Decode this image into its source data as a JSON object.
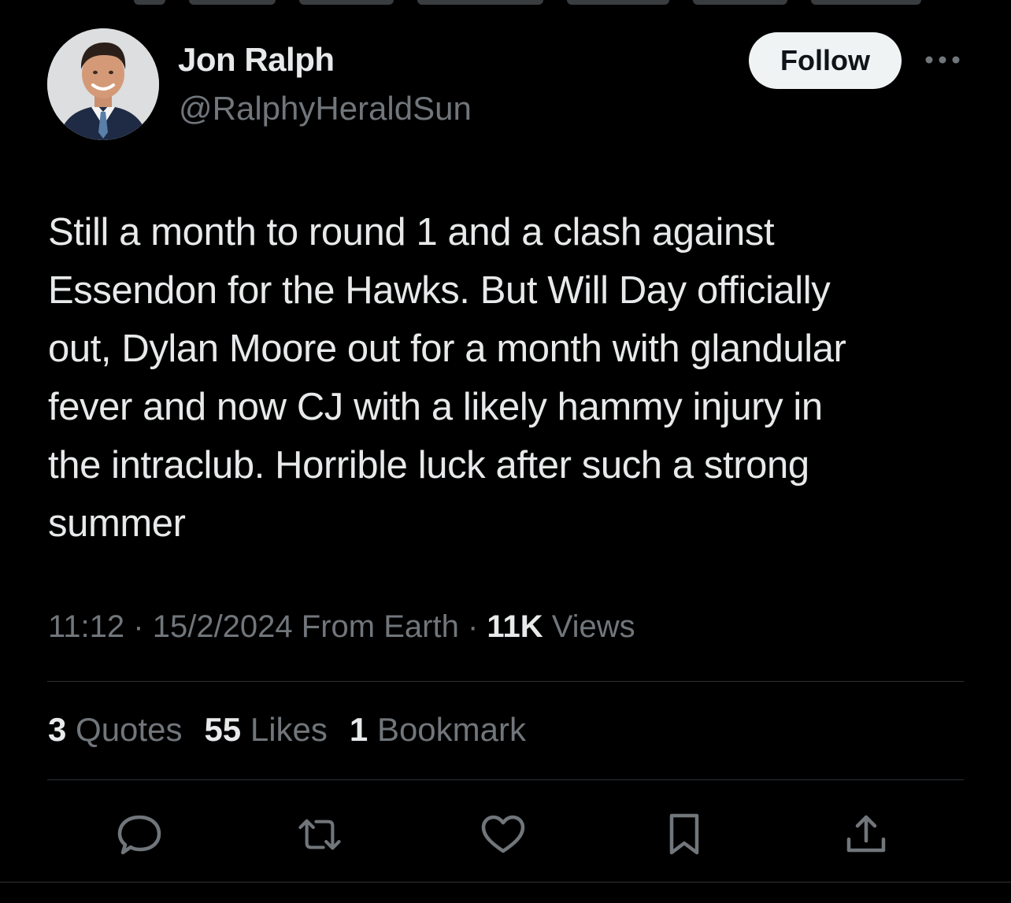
{
  "author": {
    "name": "Jon Ralph",
    "handle": "@RalphyHeraldSun"
  },
  "follow_label": "Follow",
  "tweet": {
    "text": "Still a month to round 1 and a clash against\nEssendon for the Hawks. But Will Day officially\nout, Dylan Moore out for a month with glandular\nfever and now CJ with a likely hammy injury in\nthe intraclub. Horrible luck after such a strong\nsummer"
  },
  "meta": {
    "time": "11:12",
    "separator": "·",
    "date_source": "15/2/2024 From Earth",
    "views_count": "11K",
    "views_label": "Views"
  },
  "stats": {
    "quotes_count": "3",
    "quotes_label": "Quotes",
    "likes_count": "55",
    "likes_label": "Likes",
    "bookmarks_count": "1",
    "bookmarks_label": "Bookmark"
  },
  "icons": {
    "reply": "reply-icon",
    "retweet": "retweet-icon",
    "like": "heart-icon",
    "bookmark": "bookmark-icon",
    "share": "share-icon",
    "more": "more-icon"
  },
  "colors": {
    "background": "#000000",
    "text_primary": "#e7e9ea",
    "text_secondary": "#71767b",
    "divider": "#2f3336",
    "follow_bg": "#eff3f4"
  }
}
